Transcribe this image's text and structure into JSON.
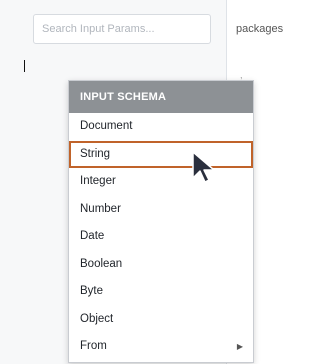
{
  "search": {
    "placeholder": "Search Input Params..."
  },
  "right_panel": {
    "label": "packages",
    "tick": ","
  },
  "menu": {
    "header": "INPUT SCHEMA",
    "items": [
      {
        "label": "Document"
      },
      {
        "label": "String"
      },
      {
        "label": "Integer"
      },
      {
        "label": "Number"
      },
      {
        "label": "Date"
      },
      {
        "label": "Boolean"
      },
      {
        "label": "Byte"
      },
      {
        "label": "Object"
      },
      {
        "label": "From"
      }
    ],
    "highlighted_item": "String"
  },
  "colors": {
    "header_bg": "#8d9195",
    "highlight_border": "#c0632a",
    "cursor_fill": "#2a2f3d"
  },
  "icons": {
    "submenu": "chevron-right-icon",
    "pointer": "mouse-pointer-icon"
  }
}
